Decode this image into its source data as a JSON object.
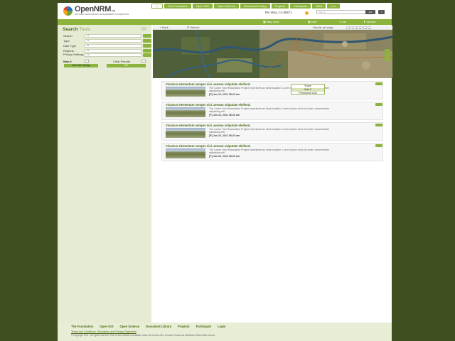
{
  "brand": {
    "name": "OpenNRM",
    "name_suffix": ".org",
    "tagline": "NATURAL RESOURCES MANAGEMENT FOUNDATION"
  },
  "topnav": [
    "The Foundation",
    "Open GIS",
    "Open Science",
    "Document Library",
    "Projects",
    "Participate",
    "Wikis"
  ],
  "header": {
    "location": "Rio Vista, CA 95571",
    "search_placeholder": "Search",
    "search_button": "GO",
    "help": "?"
  },
  "greenbar": {
    "map_view": "Map View",
    "grid": "Grid",
    "list": "List",
    "upload": "Upload"
  },
  "sidebar": {
    "title_bold": "Search",
    "title_light": "Tools",
    "filters": [
      {
        "label": "Search",
        "value": "All"
      },
      {
        "label": "Type",
        "value": "All"
      },
      {
        "label": "Date Type",
        "value": "All"
      },
      {
        "label": "Regions",
        "value": "All"
      },
      {
        "label": "Privacy Settings",
        "value": "All"
      }
    ],
    "map_it": "Map It",
    "clear_results": "Clear Results",
    "view_all": "View All Listings",
    "go": "GO"
  },
  "mapbar": {
    "back": "« Back",
    "refresh": "Refresh",
    "results_per_page": "Results per page",
    "pages": [
      "1",
      "2",
      "3",
      "4"
    ]
  },
  "results": [
    {
      "title": "Vivamus elementum semper nisi. aenean vulputate eleifend.",
      "desc": "The Lower Yolo Restoration Project represents an ideal location. Lorem ipsum dolor sit amet, consectetuer adipiscing elit.",
      "date": "[P] Jan 22, 2011 08:23 am"
    },
    {
      "title": "Vivamus elementum semper nisi. aenean vulputate eleifend.",
      "desc": "The Lower Yolo Restoration Project represents an ideal location. Lorem ipsum dolor sit amet, consectetuer adipiscing elit.",
      "date": "[P] Jan 22, 2011 08:23 am"
    },
    {
      "title": "Vivamus elementum semper nisi. aenean vulputate eleifend.",
      "desc": "The Lower Yolo Restoration Project represents an ideal location. Lorem ipsum dolor sit amet, consectetuer adipiscing elit.",
      "date": "[P] Jan 22, 2011 08:23 am"
    },
    {
      "title": "Vivamus elementum semper nisi. aenean vulputate eleifend.",
      "desc": "The Lower Yolo Restoration Project represents an ideal location. Lorem ipsum dolor sit amet, consectetuer adipiscing elit.",
      "date": "[P] Jan 22, 2011 08:23 am"
    }
  ],
  "popup": [
    "Share",
    "Mail It",
    "Permanent Link"
  ],
  "footer": {
    "nav": [
      "The Foundation",
      "Open GIS",
      "Open Science",
      "Document Library",
      "Projects",
      "Participate",
      "Login"
    ],
    "links": "Terms and Conditions  |  Disclaimer and Privacy Statement",
    "copyright": "© Copyright 2011 - All rights reserved. Text on this website is available under the terms of the Creative Commons Attribution-Share Alike license."
  },
  "colors": {
    "accent": "#8cb33c",
    "background": "#3f4f1f",
    "sidebar": "#e6ecd4"
  }
}
